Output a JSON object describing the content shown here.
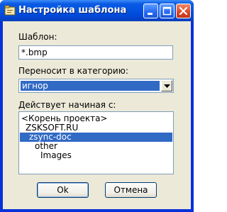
{
  "window": {
    "title": "Настройка шаблона"
  },
  "template_field": {
    "label": "Шаблон:",
    "value": "*.bmp"
  },
  "category_field": {
    "label": "Переносит в категорию:",
    "selected_value": "игнор"
  },
  "start_tree": {
    "label": "Действует начиная с:",
    "items": [
      {
        "text": "<Корень проекта>",
        "level": 0,
        "selected": false
      },
      {
        "text": "ZSKSOFT.RU",
        "level": 1,
        "selected": false
      },
      {
        "text": "zsync-doc",
        "level": 2,
        "selected": true
      },
      {
        "text": "other",
        "level": 3,
        "selected": false
      },
      {
        "text": "Images",
        "level": 4,
        "selected": false
      }
    ]
  },
  "buttons": {
    "ok_label": "Ok",
    "cancel_label": "Отмена"
  },
  "colors": {
    "titlebar": "#0054e3",
    "selection": "#316ac5",
    "dialog_bg": "#ece9d8"
  }
}
